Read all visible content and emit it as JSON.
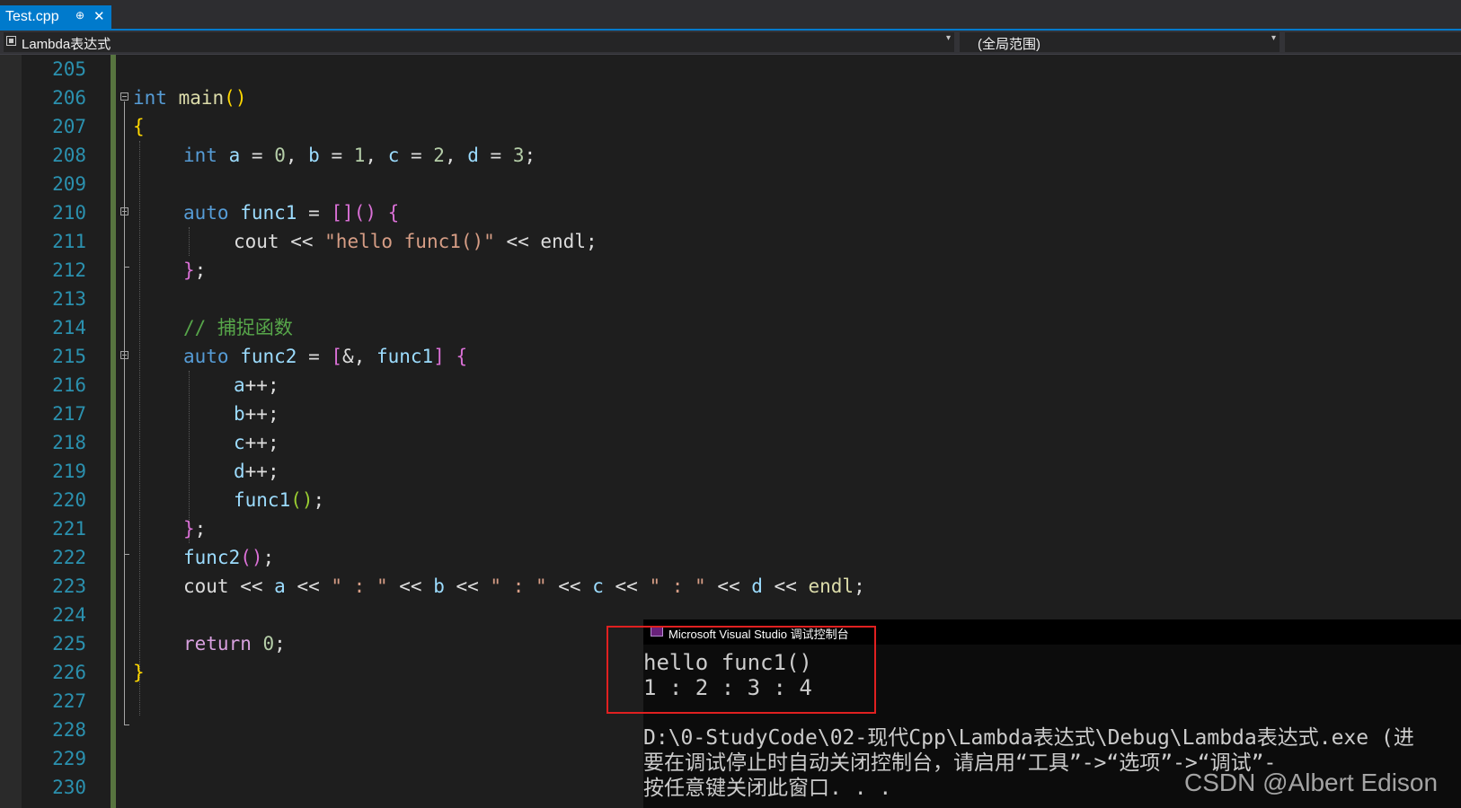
{
  "tab": {
    "title": "Test.cpp",
    "pin_glyph": "⊕",
    "close_glyph": "✕"
  },
  "nav": {
    "scope_left": "Lambda表达式",
    "scope_mid": "(全局范围)",
    "dropdown_glyph": "▾"
  },
  "line_numbers": [
    "205",
    "206",
    "207",
    "208",
    "209",
    "210",
    "211",
    "212",
    "213",
    "214",
    "215",
    "216",
    "217",
    "218",
    "219",
    "220",
    "221",
    "222",
    "223",
    "224",
    "225",
    "226",
    "227",
    "228",
    "229",
    "230"
  ],
  "code": {
    "l206": [
      "int",
      " ",
      "main",
      "()"
    ],
    "l207": [
      "{"
    ],
    "l208": [
      "int",
      " ",
      "a",
      " = ",
      "0",
      ", ",
      "b",
      " = ",
      "1",
      ", ",
      "c",
      " = ",
      "2",
      ", ",
      "d",
      " = ",
      "3",
      ";"
    ],
    "l210": [
      "auto",
      " ",
      "func1",
      " = ",
      "[]",
      "()",
      " ",
      "{"
    ],
    "l211": [
      "cout",
      " << ",
      "\"hello func1()\"",
      " << ",
      "endl",
      ";"
    ],
    "l212": [
      "}",
      ";"
    ],
    "l214": [
      "// 捕捉函数"
    ],
    "l215": [
      "auto",
      " ",
      "func2",
      " = ",
      "[",
      "&, ",
      "func1",
      "]",
      " ",
      "{"
    ],
    "l216": [
      "a",
      "++;"
    ],
    "l217": [
      "b",
      "++;"
    ],
    "l218": [
      "c",
      "++;"
    ],
    "l219": [
      "d",
      "++;"
    ],
    "l220": [
      "func1",
      "()",
      ";"
    ],
    "l221": [
      "}",
      ";"
    ],
    "l222": [
      "func2",
      "()",
      ";"
    ],
    "l223": [
      "cout",
      " << ",
      "a",
      " << ",
      "\" : \"",
      " << ",
      "b",
      " << ",
      "\" : \"",
      " << ",
      "c",
      " << ",
      "\" : \"",
      " << ",
      "d",
      " << ",
      "endl",
      ";"
    ],
    "l225": [
      "return",
      " ",
      "0",
      ";"
    ],
    "l226": [
      "}"
    ]
  },
  "console": {
    "title": "Microsoft Visual Studio 调试控制台",
    "lines": [
      "hello func1()",
      "1 : 2 : 3 : 4",
      "",
      "D:\\0-StudyCode\\02-现代Cpp\\Lambda表达式\\Debug\\Lambda表达式.exe (进",
      "要在调试停止时自动关闭控制台，请启用“工具”->“选项”->“调试”-",
      "按任意键关闭此窗口. . ."
    ]
  },
  "watermark": "CSDN @Albert Edison",
  "colors": {
    "accent": "#007acc",
    "change_bar": "#57743f",
    "line_number": "#2b91af",
    "highlight_box": "#e02020"
  }
}
